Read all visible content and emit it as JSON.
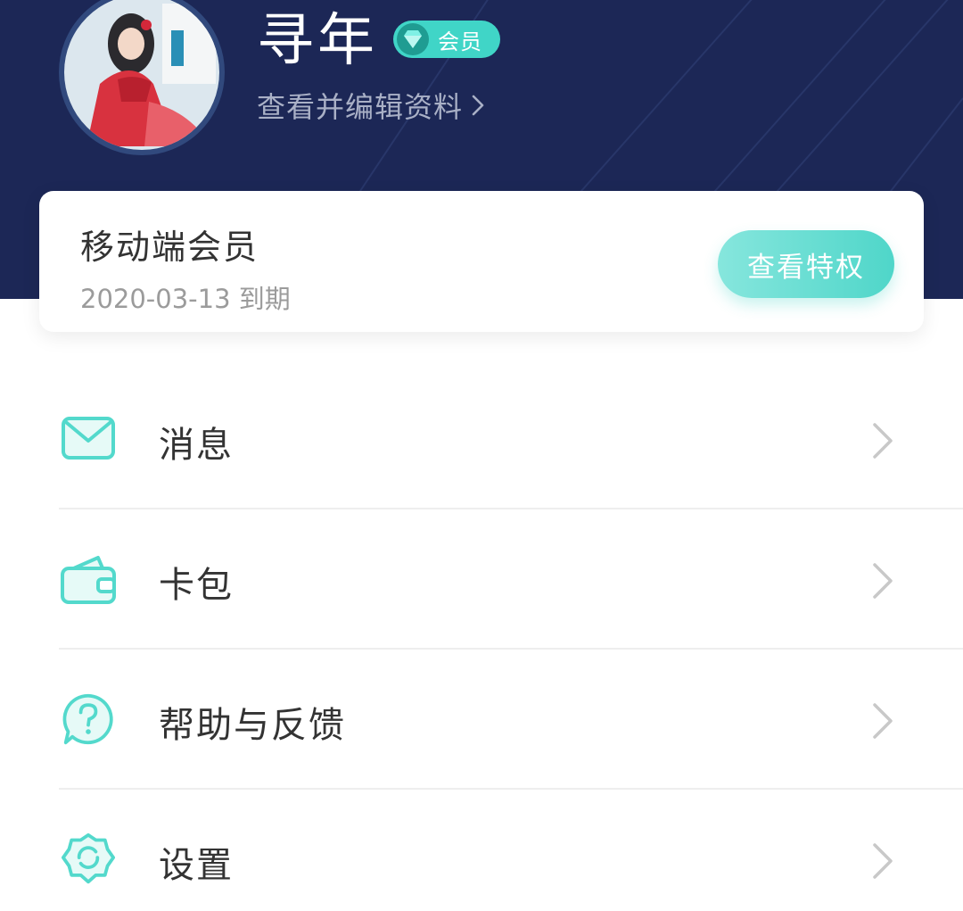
{
  "header": {
    "username": "寻年",
    "badge_label": "会员",
    "profile_link": "查看并编辑资料"
  },
  "member_card": {
    "title": "移动端会员",
    "expiry": "2020-03-13 到期",
    "button": "查看特权"
  },
  "menu": {
    "items": [
      {
        "label": "消息",
        "icon": "mail-icon"
      },
      {
        "label": "卡包",
        "icon": "wallet-icon"
      },
      {
        "label": "帮助与反馈",
        "icon": "help-icon"
      },
      {
        "label": "设置",
        "icon": "settings-icon"
      }
    ]
  },
  "colors": {
    "header_bg": "#1c2756",
    "accent": "#4fd6c9",
    "text_primary": "#333333",
    "text_secondary": "#9b9b9b"
  }
}
